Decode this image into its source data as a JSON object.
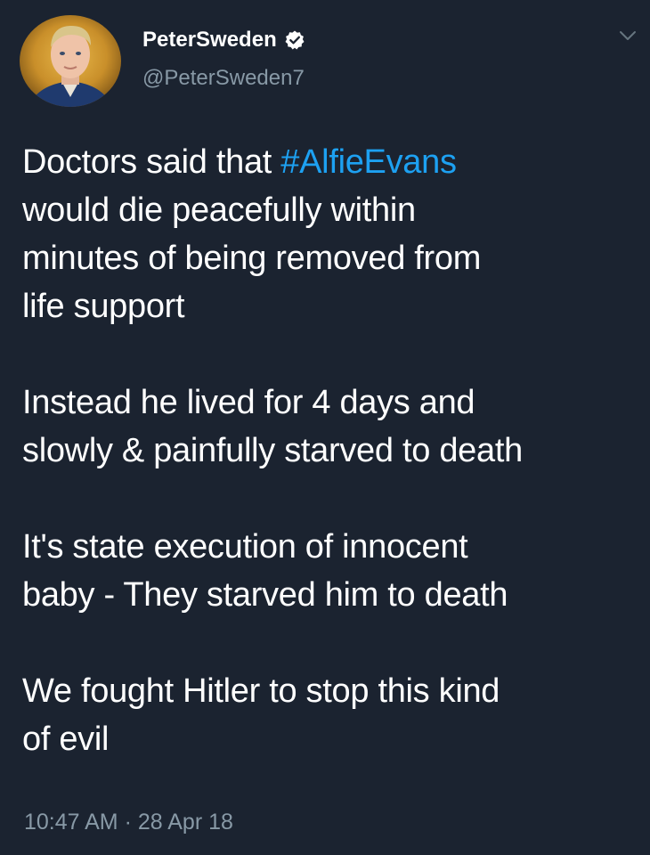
{
  "author": {
    "display_name": "PeterSweden",
    "handle": "@PeterSweden7",
    "verified": true
  },
  "tweet": {
    "paragraphs": [
      {
        "lines": [
          {
            "prefix": "Doctors said that ",
            "hashtag": "#AlfieEvans"
          },
          {
            "text": "would die peacefully within"
          },
          {
            "text": "minutes of being removed from"
          },
          {
            "text": "life support"
          }
        ]
      },
      {
        "lines": [
          {
            "text": "Instead he lived for 4 days and"
          },
          {
            "text": "slowly & painfully starved to death"
          }
        ]
      },
      {
        "lines": [
          {
            "text": "It's state execution of innocent"
          },
          {
            "text": "baby - They starved him to death"
          }
        ]
      },
      {
        "lines": [
          {
            "text": "We fought Hitler to stop this kind"
          },
          {
            "text": "of evil"
          }
        ]
      }
    ]
  },
  "meta": {
    "time": "10:47 AM",
    "separator": "·",
    "date": "28 Apr 18"
  },
  "icons": {
    "avatar": "profile-photo",
    "verified": "verified-badge-icon",
    "menu": "chevron-down-icon"
  },
  "colors": {
    "background": "#1b2330",
    "text": "#ffffff",
    "secondary_text": "#8899a6",
    "link": "#1da1f2"
  }
}
